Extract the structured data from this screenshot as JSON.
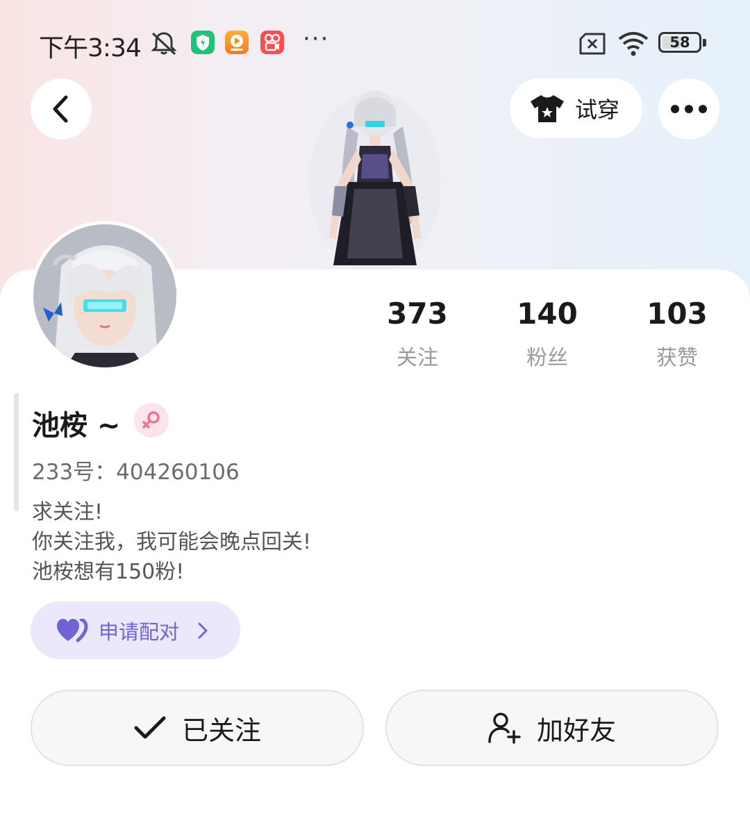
{
  "status_bar": {
    "time": "下午3:34",
    "battery": "58",
    "battery_level": 0.58,
    "icons": [
      "mute-icon",
      "security-app-icon",
      "video-app-icon",
      "kuaishou-app-icon",
      "sim-off-icon",
      "wifi-icon",
      "battery-icon"
    ]
  },
  "header": {
    "tryon_label": "试穿"
  },
  "stats": [
    {
      "value": "373",
      "label": "关注"
    },
    {
      "value": "140",
      "label": "粉丝"
    },
    {
      "value": "103",
      "label": "获赞"
    }
  ],
  "profile": {
    "name": "池桉 ~",
    "gender": "female",
    "uid": "233号：404260106",
    "bio": [
      "求关注!",
      "你关注我，我可能会晚点回关!",
      "池桉想有150粉!"
    ]
  },
  "pair_button": {
    "label": "申请配对",
    "color": "#6f63d8"
  },
  "actions": {
    "follow_label": "已关注",
    "add_friend_label": "加好友"
  }
}
